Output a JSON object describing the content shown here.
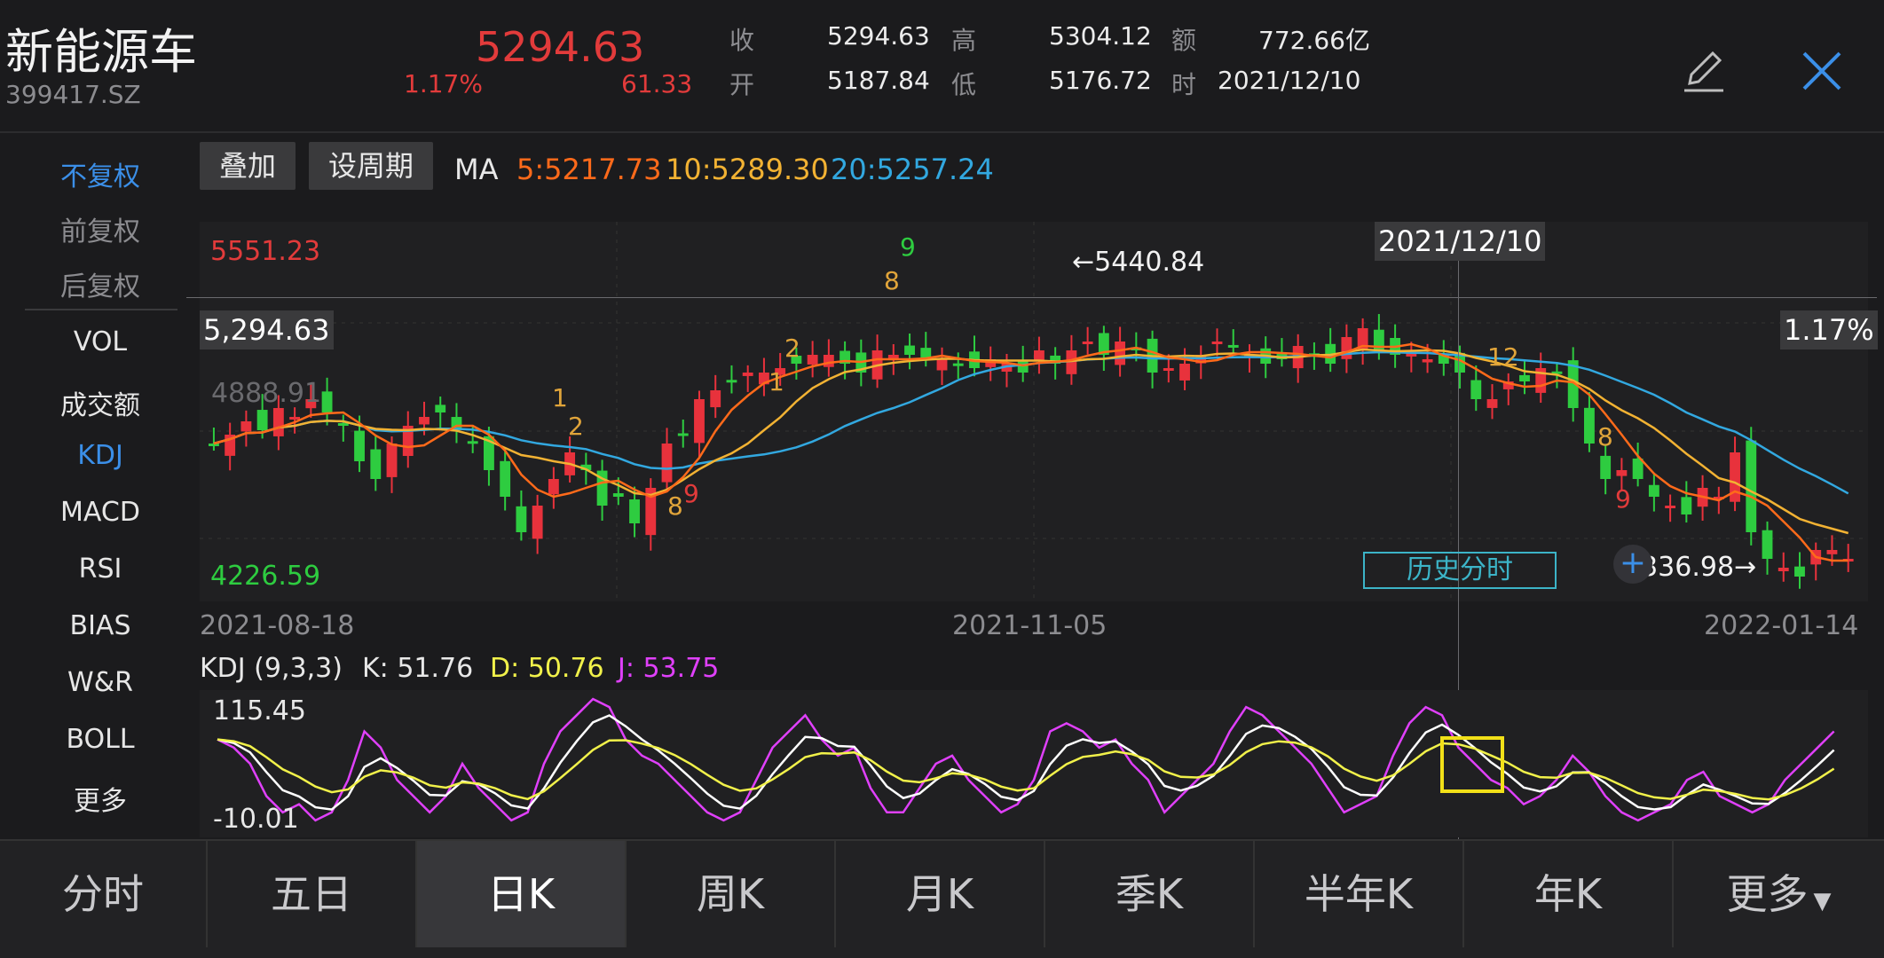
{
  "header": {
    "name": "新能源车",
    "code": "399417.SZ",
    "price": "5294.63",
    "change_pct": "1.17%",
    "change": "61.33",
    "stats": [
      {
        "k": "收",
        "v": "5294.63"
      },
      {
        "k": "高",
        "v": "5304.12"
      },
      {
        "k": "额",
        "v": "772.66亿"
      },
      {
        "k": "开",
        "v": "5187.84"
      },
      {
        "k": "低",
        "v": "5176.72"
      },
      {
        "k": "时",
        "v": "2021/12/10"
      }
    ]
  },
  "toolbar": {
    "overlay": "叠加",
    "period": "设周期",
    "ma_label": "MA",
    "ma5": "5:5217.73",
    "ma10": "10:5289.30",
    "ma20": "20:5257.24"
  },
  "left_menu": [
    "不复权",
    "前复权",
    "后复权",
    "VOL",
    "成交额",
    "KDJ",
    "MACD",
    "RSI",
    "BIAS",
    "W&R",
    "BOLL",
    "更多"
  ],
  "main_chart": {
    "ymax_label": "5551.23",
    "ymin_label": "4226.59",
    "current_price_tag": "5,294.63",
    "pct_tag": "1.17%",
    "ghost_label": "4888.91",
    "crosshair_date": "2021/12/10",
    "high_annot": "5440.84",
    "low_annot": "4336.98",
    "history_btn": "历史分时",
    "x_labels": [
      "2021-08-18",
      "2021-11-05",
      "2022-01-14"
    ],
    "td_markers": [
      "1",
      "2",
      "8",
      "9",
      "2",
      "1",
      "9",
      "8",
      "12",
      "8",
      "9"
    ]
  },
  "kdj": {
    "label": "KDJ (9,3,3)",
    "k": "K: 51.76",
    "d": "D: 50.76",
    "j": "J: 53.75",
    "ymax": "115.45",
    "ymin": "-10.01"
  },
  "tabs": [
    "分时",
    "五日",
    "日K",
    "周K",
    "月K",
    "季K",
    "半年K",
    "年K",
    "更多"
  ],
  "colors": {
    "up": "#e8323c",
    "down": "#2ecc40",
    "ma5": "#ff6a1a",
    "ma10": "#f2b233",
    "ma20": "#32a8e0",
    "k": "#ffffff",
    "d": "#f1f14a",
    "j": "#e040fb",
    "accent": "#3b8fe8"
  }
}
